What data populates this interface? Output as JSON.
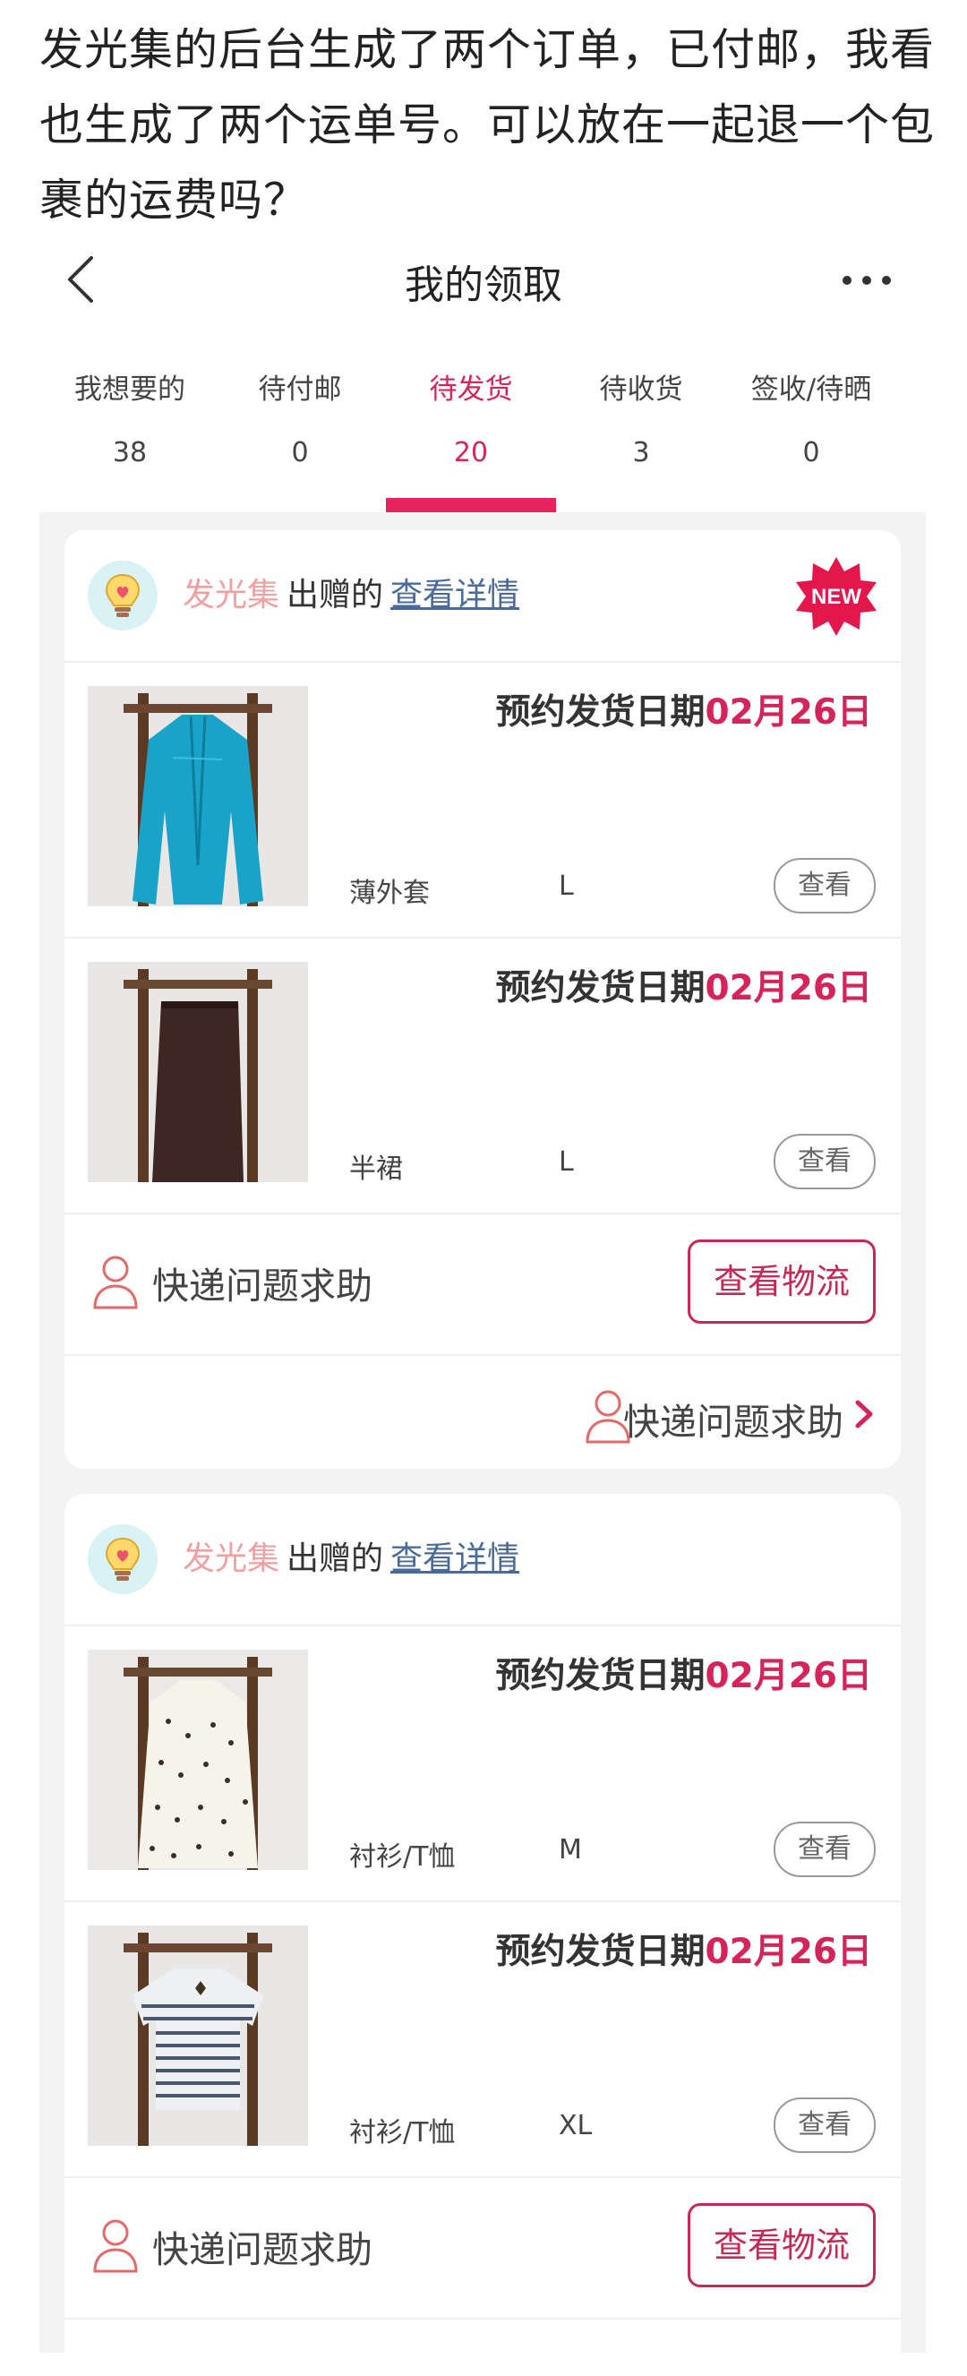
{
  "question": "发光集的后台生成了两个订单，已付邮，我看也生成了两个运单号。可以放在一起退一个包裹的运费吗？",
  "nav": {
    "title": "我的领取"
  },
  "tabs": [
    {
      "label": "我想要的",
      "count": "38"
    },
    {
      "label": "待付邮",
      "count": "0"
    },
    {
      "label": "待发货",
      "count": "20"
    },
    {
      "label": "待收货",
      "count": "3"
    },
    {
      "label": "签收/待晒",
      "count": "0"
    }
  ],
  "active_tab": "待发货",
  "cards": [
    {
      "shop": "发光集",
      "gave": "出赠的",
      "detail": "查看详情",
      "badge": "NEW",
      "items": [
        {
          "ship_label": "预约发货日期",
          "ship_date": "02月26日",
          "category": "薄外套",
          "size": "L",
          "view": "查看",
          "photo": "teal-jacket"
        },
        {
          "ship_label": "预约发货日期",
          "ship_date": "02月26日",
          "category": "半裙",
          "size": "L",
          "view": "查看",
          "photo": "brown-skirt"
        }
      ],
      "help": "快递问题求助",
      "logistics": "查看物流",
      "footer_help": "快递问题求助"
    },
    {
      "shop": "发光集",
      "gave": "出赠的",
      "detail": "查看详情",
      "items": [
        {
          "ship_label": "预约发货日期",
          "ship_date": "02月26日",
          "category": "衬衫/T恤",
          "size": "M",
          "view": "查看",
          "photo": "dotted-blouse"
        },
        {
          "ship_label": "预约发货日期",
          "ship_date": "02月26日",
          "category": "衬衫/T恤",
          "size": "XL",
          "view": "查看",
          "photo": "striped-tee"
        }
      ],
      "help": "快递问题求助",
      "logistics": "查看物流"
    }
  ],
  "colors": {
    "accent": "#d6245a",
    "shop": "#f0a0a0",
    "link": "#4a6a9a",
    "page_bg": "#f3f3f3"
  }
}
